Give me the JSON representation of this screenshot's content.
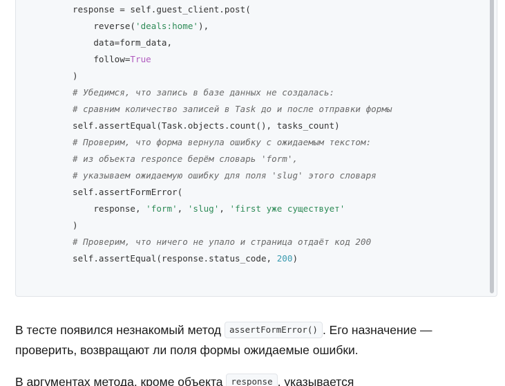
{
  "code_block": {
    "lines": [
      {
        "indent": "        ",
        "tokens": [
          {
            "text": "response = self.guest_client.post(",
            "type": "plain"
          }
        ]
      },
      {
        "indent": "            ",
        "tokens": [
          {
            "text": "reverse(",
            "type": "plain"
          },
          {
            "text": "'deals:home'",
            "type": "string"
          },
          {
            "text": "),",
            "type": "plain"
          }
        ]
      },
      {
        "indent": "            ",
        "tokens": [
          {
            "text": "data=form_data,",
            "type": "plain"
          }
        ]
      },
      {
        "indent": "            ",
        "tokens": [
          {
            "text": "follow=",
            "type": "plain"
          },
          {
            "text": "True",
            "type": "keyword"
          }
        ]
      },
      {
        "indent": "        ",
        "tokens": [
          {
            "text": ")",
            "type": "plain"
          }
        ]
      },
      {
        "indent": "        ",
        "tokens": [
          {
            "text": "# Убедимся, что запись в базе данных не создалась:",
            "type": "comment"
          }
        ]
      },
      {
        "indent": "        ",
        "tokens": [
          {
            "text": "# сравним количество записей в Task до и после отправки формы",
            "type": "comment"
          }
        ]
      },
      {
        "indent": "        ",
        "tokens": [
          {
            "text": "self.assertEqual(Task.objects.count(), tasks_count)",
            "type": "plain"
          }
        ]
      },
      {
        "indent": "        ",
        "tokens": [
          {
            "text": "# Проверим, что форма вернула ошибку с ожидаемым текстом:",
            "type": "comment"
          }
        ]
      },
      {
        "indent": "        ",
        "tokens": [
          {
            "text": "# из объекта responce берём словарь 'form',",
            "type": "comment"
          }
        ]
      },
      {
        "indent": "        ",
        "tokens": [
          {
            "text": "# указываем ожидаемую ошибку для поля 'slug' этого словаря",
            "type": "comment"
          }
        ]
      },
      {
        "indent": "        ",
        "tokens": [
          {
            "text": "self.assertFormError(",
            "type": "plain"
          }
        ]
      },
      {
        "indent": "            ",
        "tokens": [
          {
            "text": "response, ",
            "type": "plain"
          },
          {
            "text": "'form'",
            "type": "string"
          },
          {
            "text": ", ",
            "type": "plain"
          },
          {
            "text": "'slug'",
            "type": "string"
          },
          {
            "text": ", ",
            "type": "plain"
          },
          {
            "text": "'first уже существует'",
            "type": "string"
          }
        ]
      },
      {
        "indent": "        ",
        "tokens": [
          {
            "text": ")",
            "type": "plain"
          }
        ]
      },
      {
        "indent": "        ",
        "tokens": [
          {
            "text": "# Проверим, что ничего не упало и страница отдаёт код 200",
            "type": "comment"
          }
        ]
      },
      {
        "indent": "        ",
        "tokens": [
          {
            "text": "self.assertEqual(response.status_code, ",
            "type": "plain"
          },
          {
            "text": "200",
            "type": "number"
          },
          {
            "text": ")",
            "type": "plain"
          }
        ]
      }
    ]
  },
  "paragraph1": {
    "part1": "В тесте появился незнакомый метод ",
    "code": "assertFormError()",
    "part2": ". Его назначение — проверить, возвращают ли поля формы ожидаемые ошибки."
  },
  "paragraph2": {
    "part1": "В аргументах метода, кроме объекта ",
    "code": "response",
    "part2": ", указывается"
  },
  "colors": {
    "code_background": "#f6f8fa",
    "string": "#2e8b57",
    "keyword": "#b15cbf",
    "number": "#3a9bb0",
    "comment": "#6a6a6a"
  }
}
